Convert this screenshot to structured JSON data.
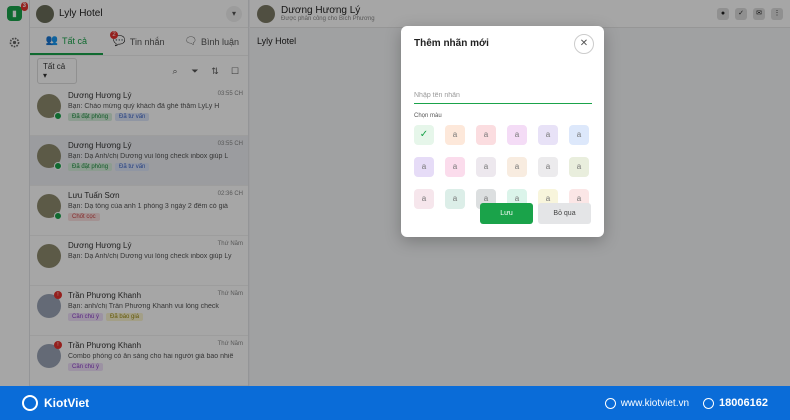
{
  "rail": {
    "badge": "3"
  },
  "left": {
    "hotel_name": "Lyly Hotel",
    "tabs": [
      {
        "label": "Tất cả",
        "badge": ""
      },
      {
        "label": "Tin nhắn",
        "badge": "2"
      },
      {
        "label": "Bình luận",
        "badge": ""
      }
    ],
    "filter_value": "Tất cả",
    "conversations": [
      {
        "name": "Dương Hương Lý",
        "time": "03:55 CH",
        "msg": "Bạn: Chào mừng quý khách đã ghé thăm LyLy H",
        "tags": [
          {
            "t": "Đã đặt phòng",
            "c": "g"
          },
          {
            "t": "Đã tư vấn",
            "c": "bl"
          }
        ]
      },
      {
        "name": "Dương Hương Lý",
        "time": "03:55 CH",
        "msg": "Bạn: Dạ Anh/chị Dương vui lòng check inbox giúp L",
        "tags": [
          {
            "t": "Đã đặt phòng",
            "c": "g"
          },
          {
            "t": "Đã tư vấn",
            "c": "bl"
          }
        ]
      },
      {
        "name": "Lưu Tuấn Sơn",
        "time": "02:36 CH",
        "msg": "Bạn: Dạ tổng của anh 1 phòng 3 ngày 2 đêm có giá",
        "tags": [
          {
            "t": "Chốt cọc",
            "c": "pk"
          }
        ]
      },
      {
        "name": "Dương Hương Lý",
        "time": "Thứ Năm",
        "msg": "Bạn: Dạ Anh/chị Dương vui lòng check inbox giúp Ly",
        "tags": []
      },
      {
        "name": "Trần Phương Khanh",
        "time": "Thứ Năm",
        "msg": "Bạn: anh/chị Trần Phương Khanh vui lòng check",
        "tags": [
          {
            "t": "Cần chú ý",
            "c": "vi"
          },
          {
            "t": "Đã báo giá",
            "c": "yl"
          }
        ]
      },
      {
        "name": "Trần Phương Khanh",
        "time": "Thứ Năm",
        "msg": "Combo phòng có ăn sáng cho hai người giá bao nhiê",
        "tags": [
          {
            "t": "Cần chú ý",
            "c": "vi"
          }
        ]
      }
    ]
  },
  "main": {
    "contact_name": "Dương Hương Lý",
    "contact_sub": "Được phân công cho Bích Phương",
    "page_name": "Lyly Hotel"
  },
  "modal": {
    "title": "Thêm nhãn mới",
    "placeholder": "Nhập tên nhãn",
    "color_label": "Chọn màu",
    "swatch_letter": "a",
    "colors": [
      "#e6f6ea",
      "#fde8da",
      "#fbdde0",
      "#f4dcf6",
      "#e8e2f7",
      "#dde8fb",
      "#e6dcf7",
      "#fbdcec",
      "#ede8ee",
      "#f8ece0",
      "#ecebed",
      "#e9eedd",
      "#f6e6ec",
      "#dceee8",
      "#dcdfe0",
      "#dbf4ea",
      "#f8f5dc",
      "#fbe6e6"
    ],
    "save_label": "Lưu",
    "skip_label": "Bỏ qua"
  },
  "footer": {
    "brand": "KiotViet",
    "website": "www.kiotviet.vn",
    "phone": "18006162"
  }
}
